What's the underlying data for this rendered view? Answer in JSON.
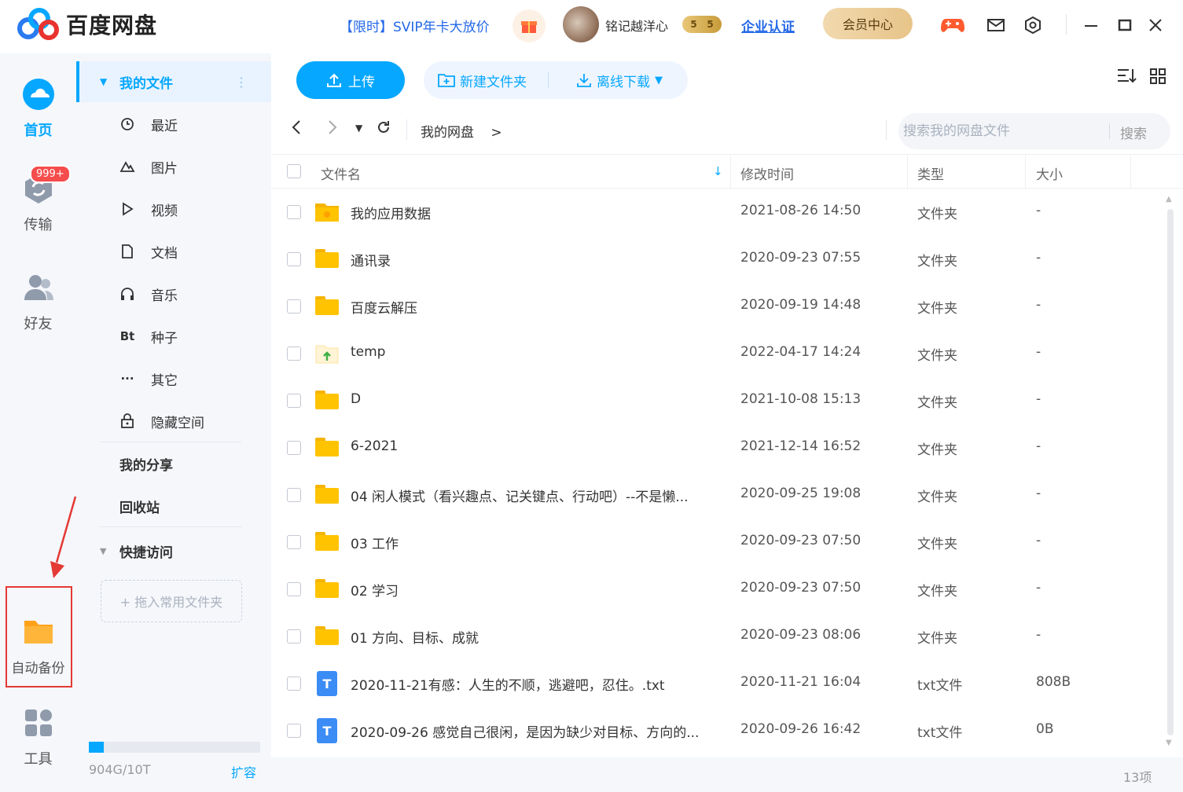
{
  "app": {
    "logo_text": "百度网盘",
    "promo": "【限时】SVIP年卡大放价",
    "username": "铭记越洋心",
    "svip_badge": [
      "5",
      "5"
    ],
    "enterprise": "企业认证",
    "member_center": "会员中心"
  },
  "leftnav": {
    "home": "首页",
    "transfer": "传输",
    "transfer_badge": "999+",
    "friends": "好友",
    "auto_backup": "自动备份",
    "tools": "工具"
  },
  "sidebar": {
    "my_files": "我的文件",
    "items": [
      {
        "label": "最近",
        "icon": "clock-icon"
      },
      {
        "label": "图片",
        "icon": "image-icon"
      },
      {
        "label": "视频",
        "icon": "play-icon"
      },
      {
        "label": "文档",
        "icon": "document-icon"
      },
      {
        "label": "音乐",
        "icon": "headphones-icon"
      },
      {
        "label": "种子",
        "icon": "bt-icon",
        "glyph": "Bt"
      },
      {
        "label": "其它",
        "icon": "more-icon",
        "glyph": "···"
      },
      {
        "label": "隐藏空间",
        "icon": "lock-icon"
      }
    ],
    "my_share": "我的分享",
    "recycle": "回收站",
    "quick_access": "快捷访问",
    "dropzone": "+ 拖入常用文件夹",
    "quota_text": "904G/10T",
    "quota_fraction": 0.088,
    "expand": "扩容"
  },
  "toolbar": {
    "upload": "上传",
    "new_folder": "新建文件夹",
    "offline_download": "离线下载"
  },
  "path": {
    "breadcrumb": "我的网盘",
    "breadcrumb_sep": ">",
    "search_placeholder": "搜索我的网盘文件",
    "search_button": "搜索"
  },
  "table": {
    "headers": {
      "name": "文件名",
      "modified": "修改时间",
      "type": "类型",
      "size": "大小"
    },
    "rows": [
      {
        "name": "我的应用数据",
        "date": "2021-08-26 14:50",
        "type": "文件夹",
        "size": "-",
        "kind": "folder-app"
      },
      {
        "name": "通讯录",
        "date": "2020-09-23 07:55",
        "type": "文件夹",
        "size": "-",
        "kind": "folder"
      },
      {
        "name": "百度云解压",
        "date": "2020-09-19 14:48",
        "type": "文件夹",
        "size": "-",
        "kind": "folder"
      },
      {
        "name": "temp",
        "date": "2022-04-17 14:24",
        "type": "文件夹",
        "size": "-",
        "kind": "folder-upload"
      },
      {
        "name": "D",
        "date": "2021-10-08 15:13",
        "type": "文件夹",
        "size": "-",
        "kind": "folder"
      },
      {
        "name": "6-2021",
        "date": "2021-12-14 16:52",
        "type": "文件夹",
        "size": "-",
        "kind": "folder"
      },
      {
        "name": "04 闲人模式（看兴趣点、记关键点、行动吧）--不是懒...",
        "date": "2020-09-25 19:08",
        "type": "文件夹",
        "size": "-",
        "kind": "folder"
      },
      {
        "name": "03 工作",
        "date": "2020-09-23 07:50",
        "type": "文件夹",
        "size": "-",
        "kind": "folder"
      },
      {
        "name": "02 学习",
        "date": "2020-09-23 07:50",
        "type": "文件夹",
        "size": "-",
        "kind": "folder"
      },
      {
        "name": "01 方向、目标、成就",
        "date": "2020-09-23 08:06",
        "type": "文件夹",
        "size": "-",
        "kind": "folder"
      },
      {
        "name": "2020-11-21有感：人生的不顺，逃避吧，忍住。.txt",
        "date": "2020-11-21 16:04",
        "type": "txt文件",
        "size": "808B",
        "kind": "txt"
      },
      {
        "name": "2020-09-26 感觉自己很闲，是因为缺少对目标、方向的...",
        "date": "2020-09-26 16:42",
        "type": "txt文件",
        "size": "0B",
        "kind": "txt"
      }
    ],
    "count": "13项"
  },
  "colors": {
    "accent": "#06a7ff",
    "highlight_box": "#e53935",
    "folder": "#ffc300"
  }
}
